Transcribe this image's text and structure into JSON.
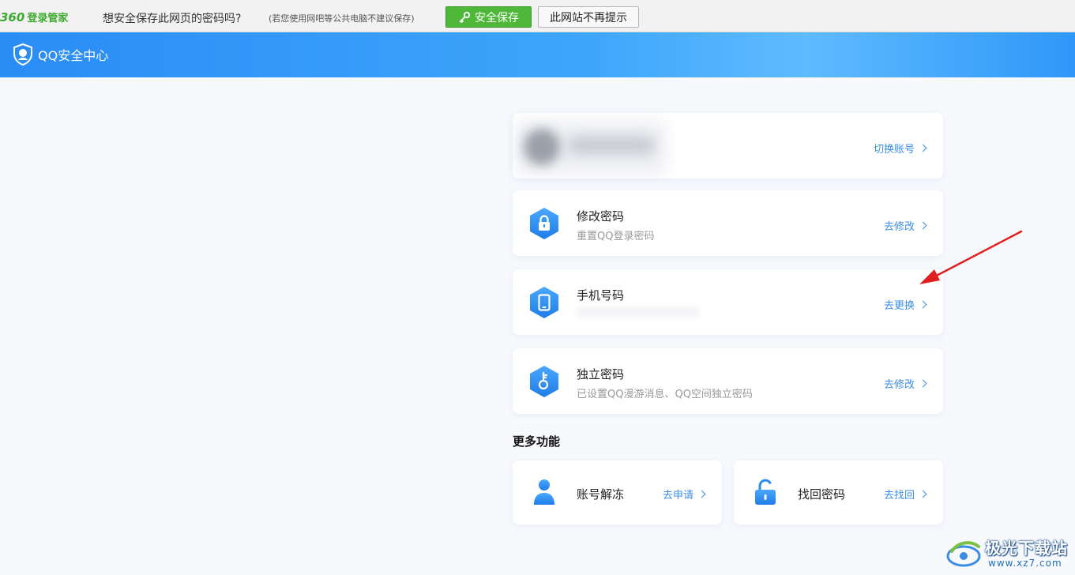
{
  "password_bar": {
    "brand": "360",
    "brand_suffix": "登录管家",
    "question": "想安全保存此网页的密码吗?",
    "note": "(若您使用网吧等公共电脑不建议保存)",
    "save_label": "安全保存",
    "never_label": "此网站不再提示"
  },
  "header": {
    "title": "QQ安全中心"
  },
  "account": {
    "switch_label": "切换账号"
  },
  "items": [
    {
      "title": "修改密码",
      "subtitle": "重置QQ登录密码",
      "action": "去修改",
      "icon": "lock-icon"
    },
    {
      "title": "手机号码",
      "subtitle": "",
      "action": "去更换",
      "icon": "phone-icon"
    },
    {
      "title": "独立密码",
      "subtitle": "已设置QQ漫游消息、QQ空间独立密码",
      "action": "去修改",
      "icon": "key-icon"
    }
  ],
  "more": {
    "title": "更多功能",
    "items": [
      {
        "title": "账号解冻",
        "action": "去申请",
        "icon": "user-icon"
      },
      {
        "title": "找回密码",
        "action": "去找回",
        "icon": "unlock-icon"
      }
    ]
  },
  "watermark": {
    "text": "极光下载站",
    "url": "www.xz7.com"
  },
  "colors": {
    "accent": "#3b8ee8",
    "header_blue": "#2a8cf5",
    "save_green": "#4fb83a",
    "annotation_red": "#e02020"
  }
}
